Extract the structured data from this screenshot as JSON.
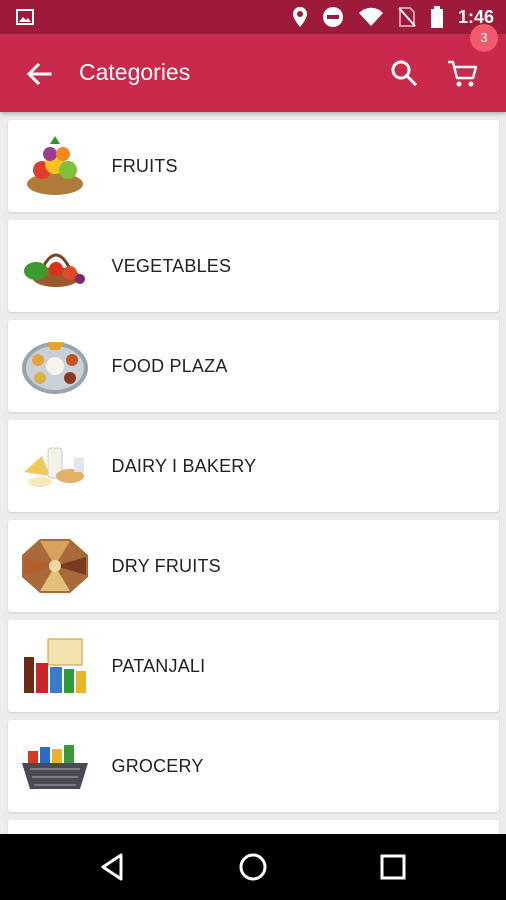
{
  "status_bar": {
    "time": "1:46",
    "icons": [
      "gallery-icon",
      "location-pin-icon",
      "do-not-disturb-icon",
      "wifi-icon",
      "no-sim-icon",
      "battery-icon"
    ]
  },
  "app_bar": {
    "title": "Categories",
    "cart_count": "3",
    "color": "#c9294b"
  },
  "categories": [
    {
      "label": "FRUITS",
      "icon": "fruit-basket-image"
    },
    {
      "label": "VEGETABLES",
      "icon": "vegetable-basket-image"
    },
    {
      "label": "FOOD PLAZA",
      "icon": "thali-plate-image"
    },
    {
      "label": "DAIRY I BAKERY",
      "icon": "dairy-bakery-image"
    },
    {
      "label": "DRY FRUITS",
      "icon": "dry-fruits-tray-image"
    },
    {
      "label": "PATANJALI",
      "icon": "patanjali-products-image"
    },
    {
      "label": "GROCERY",
      "icon": "grocery-basket-image"
    }
  ],
  "nav_bar": {
    "buttons": [
      "back-triangle-icon",
      "home-circle-icon",
      "recents-square-icon"
    ]
  }
}
